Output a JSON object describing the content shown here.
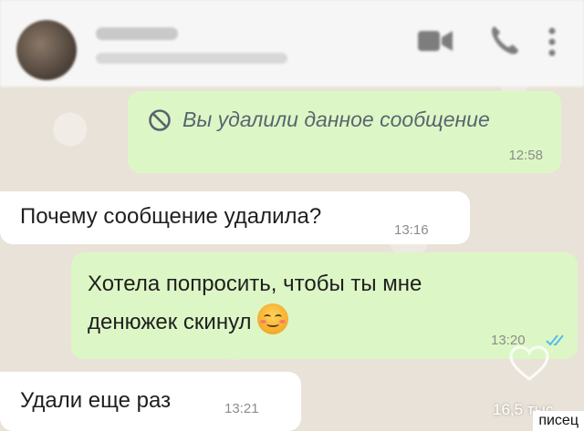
{
  "header": {
    "contact_name": "",
    "contact_status": ""
  },
  "messages": [
    {
      "direction": "outgoing",
      "text": "Вы удалили данное сообщение",
      "deleted": true,
      "time": "12:58"
    },
    {
      "direction": "incoming",
      "text": "Почему сообщение удалила?",
      "time": "13:16"
    },
    {
      "direction": "outgoing",
      "line1": "Хотела попросить, чтобы ты мне",
      "line2": "денюжек скинул",
      "emoji": "smiling-blushing-emoji",
      "time": "13:20",
      "status": "read"
    },
    {
      "direction": "incoming",
      "text": "Удали еще раз",
      "time": "13:21"
    }
  ],
  "overlay": {
    "likes": "16,5 тыс"
  },
  "watermark": "писец",
  "colors": {
    "outgoing_bubble": "#dcf7c5",
    "incoming_bubble": "#ffffff",
    "read_ticks": "#53bdeb",
    "background": "#ece5dd"
  }
}
